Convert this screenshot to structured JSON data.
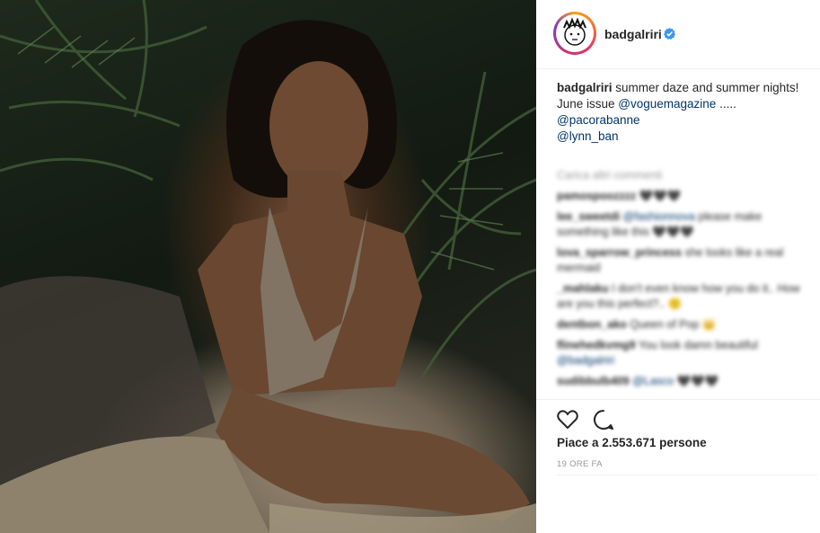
{
  "post": {
    "image_alt": "Photo",
    "author": "badgalriri",
    "caption_text": "summer daze and summer nights!",
    "caption_line2": "June issue ",
    "mention_vogue": "@voguemagazine",
    "ellipsis": " .....",
    "mention_paco": "@pacorabanne",
    "mention_lynn": "@lynn_ban",
    "load_more": "Carica altri commenti",
    "comments": [
      {
        "user": "pamospoozzzz",
        "text": "🖤🖤🖤"
      },
      {
        "user": "lee_sweetdi",
        "text": "please make something like this 🖤🖤🖤",
        "mention": "@fashionnova"
      },
      {
        "user": "lova_sparrow_princess",
        "text": "she looks like a real mermaid"
      },
      {
        "user": "_mahlaku",
        "text": "I don't even know how you do it.. How are you this perfect?.. 🙂"
      },
      {
        "user": "dentbon_ako",
        "text": "Queen of Pop 👑"
      },
      {
        "user": "flinehedkvmg9",
        "text": "You look damn beautiful",
        "mention": "@badgalriri"
      },
      {
        "user": "sudibbulb409",
        "text": "🖤🖤🖤",
        "mention": "@Lasco"
      }
    ],
    "likes": "Piace a 2.553.671 persone",
    "timestamp": "19 ORE FA"
  },
  "colors": {
    "verified": "#3897f0",
    "link": "#003569",
    "text": "#262626",
    "muted": "#999999"
  },
  "icons": {
    "like": "heart-icon",
    "comment": "comment-bubble-icon",
    "verified": "verified-badge-icon"
  }
}
